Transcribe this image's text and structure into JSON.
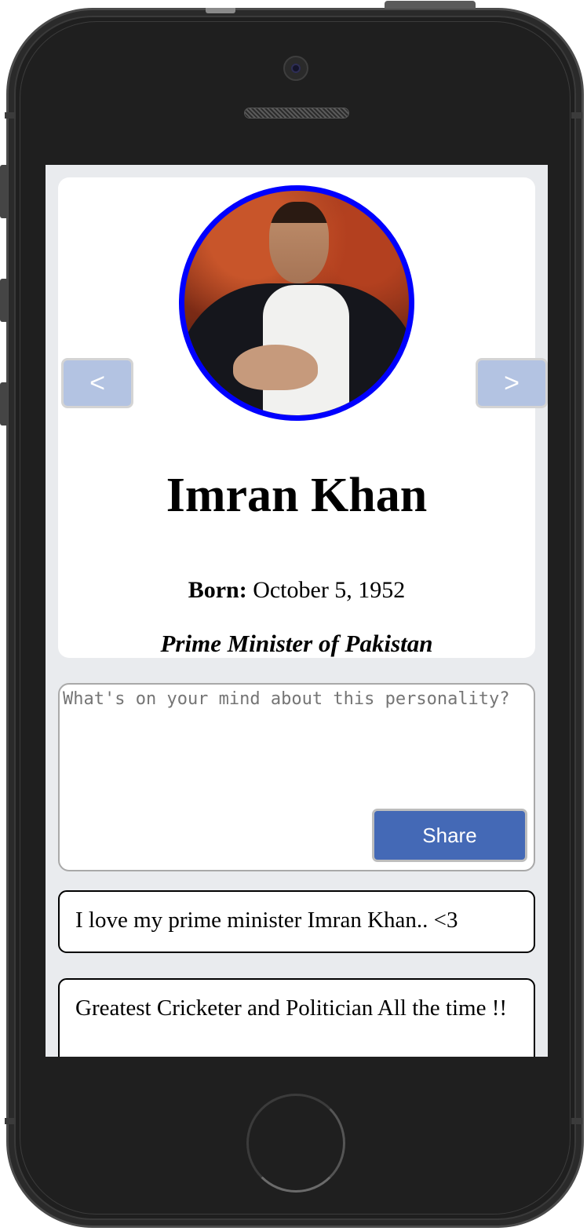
{
  "profile": {
    "name": "Imran Khan",
    "born_label": "Born:",
    "born_value": "October 5, 1952",
    "title": "Prime Minister of Pakistan",
    "avatar_border_color": "#0000ff"
  },
  "carousel": {
    "prev_label": "<",
    "next_label": ">"
  },
  "composer": {
    "placeholder": "What's on your mind about this personality?",
    "value": "",
    "share_label": "Share",
    "share_color": "#4469b6"
  },
  "comments": [
    {
      "text": "I love my prime minister Imran Khan.. <3"
    },
    {
      "text": "Greatest Cricketer and Politician All the time !!"
    }
  ]
}
